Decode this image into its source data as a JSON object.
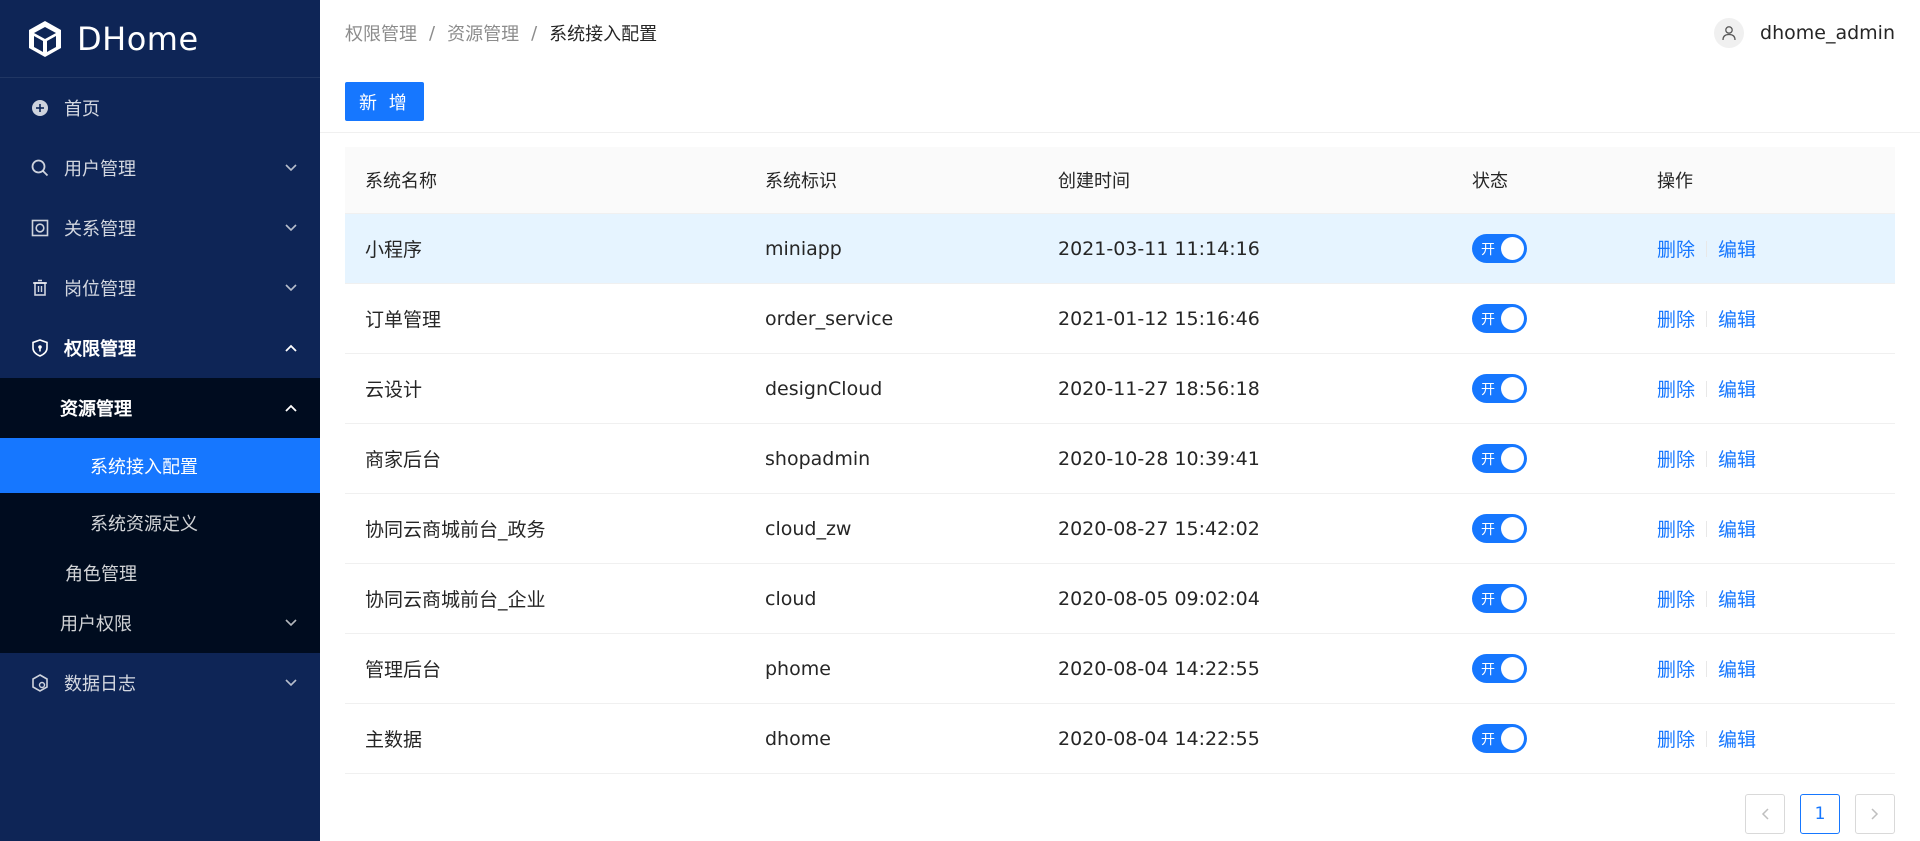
{
  "brand": {
    "name": "DHome",
    "accent": "#1677ff",
    "sidebar_bg": "#0e2556"
  },
  "sidebar": {
    "home": {
      "label": "首页",
      "icon": "plus-circle-icon"
    },
    "user_mgmt": {
      "label": "用户管理",
      "icon": "search-icon"
    },
    "relation_mgmt": {
      "label": "关系管理",
      "icon": "relation-icon"
    },
    "post_mgmt": {
      "label": "岗位管理",
      "icon": "trash-icon"
    },
    "permission_mgmt": {
      "label": "权限管理",
      "icon": "shield-icon"
    },
    "resource_mgmt": {
      "label": "资源管理"
    },
    "system_access": {
      "label": "系统接入配置"
    },
    "system_resource": {
      "label": "系统资源定义"
    },
    "role_mgmt": {
      "label": "角色管理"
    },
    "user_permission": {
      "label": "用户权限"
    },
    "data_log": {
      "label": "数据日志",
      "icon": "log-icon"
    }
  },
  "breadcrumb": {
    "level1": "权限管理",
    "level2": "资源管理",
    "current": "系统接入配置",
    "separator": "/"
  },
  "user": {
    "name": "dhome_admin"
  },
  "toolbar": {
    "add_label": "新 增"
  },
  "table": {
    "columns": {
      "name": "系统名称",
      "id": "系统标识",
      "created": "创建时间",
      "status": "状态",
      "ops": "操作"
    },
    "rows": [
      {
        "name": "小程序",
        "id": "miniapp",
        "created": "2021-03-11 11:14:16",
        "status": "开",
        "delete": "删除",
        "edit": "编辑"
      },
      {
        "name": "订单管理",
        "id": "order_service",
        "created": "2021-01-12 15:16:46",
        "status": "开",
        "delete": "删除",
        "edit": "编辑"
      },
      {
        "name": "云设计",
        "id": "designCloud",
        "created": "2020-11-27 18:56:18",
        "status": "开",
        "delete": "删除",
        "edit": "编辑"
      },
      {
        "name": "商家后台",
        "id": "shopadmin",
        "created": "2020-10-28 10:39:41",
        "status": "开",
        "delete": "删除",
        "edit": "编辑"
      },
      {
        "name": "协同云商城前台_政务",
        "id": "cloud_zw",
        "created": "2020-08-27 15:42:02",
        "status": "开",
        "delete": "删除",
        "edit": "编辑"
      },
      {
        "name": "协同云商城前台_企业",
        "id": "cloud",
        "created": "2020-08-05 09:02:04",
        "status": "开",
        "delete": "删除",
        "edit": "编辑"
      },
      {
        "name": "管理后台",
        "id": "phome",
        "created": "2020-08-04 14:22:55",
        "status": "开",
        "delete": "删除",
        "edit": "编辑"
      },
      {
        "name": "主数据",
        "id": "dhome",
        "created": "2020-08-04 14:22:55",
        "status": "开",
        "delete": "删除",
        "edit": "编辑"
      }
    ]
  },
  "pagination": {
    "current_page": "1",
    "prev": "<",
    "next": ">"
  }
}
